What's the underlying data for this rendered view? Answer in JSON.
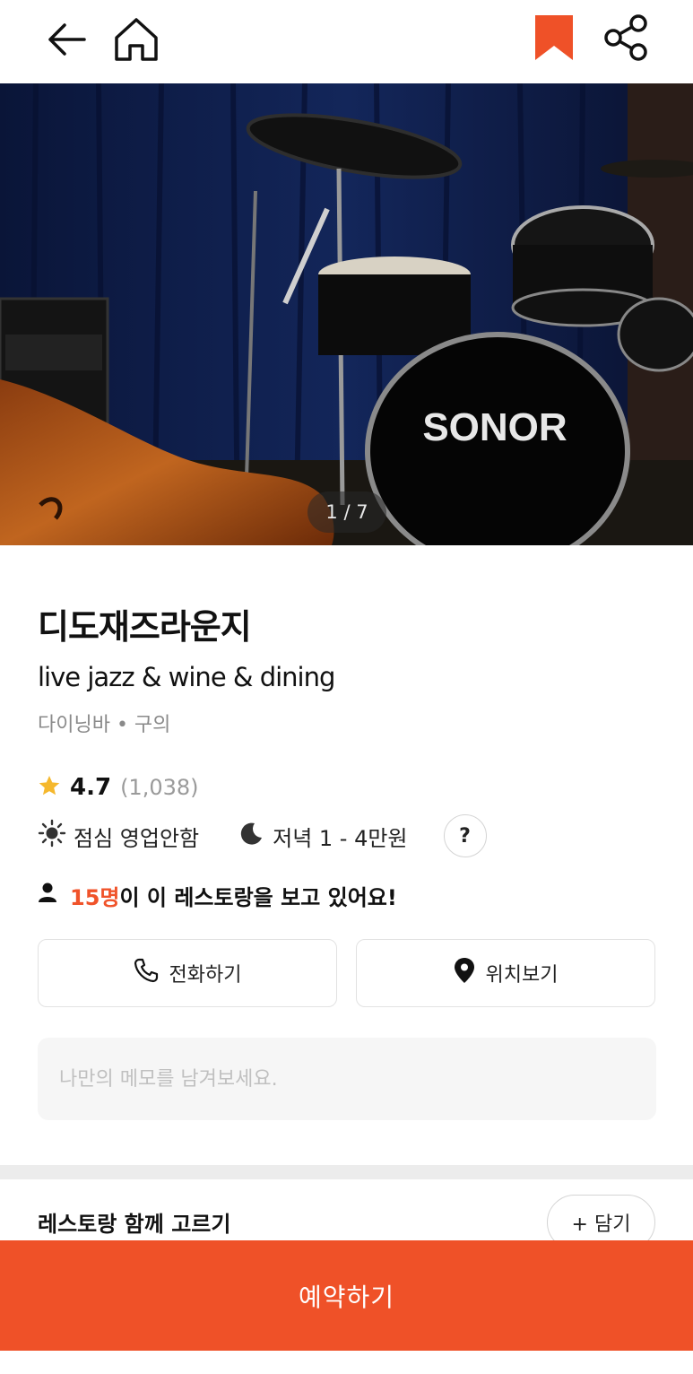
{
  "header": {
    "back_icon": "arrow-left-icon",
    "home_icon": "home-icon",
    "bookmark_icon": "bookmark-icon",
    "share_icon": "share-icon"
  },
  "gallery": {
    "counter": "1 / 7",
    "brand_text": "SONOR"
  },
  "restaurant": {
    "name": "디도재즈라운지",
    "tagline": "live jazz & wine & dining",
    "category": "다이닝바 • 구의",
    "rating": "4.7",
    "review_count": "(1,038)",
    "lunch": "점심 영업안함",
    "dinner": "저녁 1 - 4만원",
    "help_label": "?",
    "viewers_count": "15명",
    "viewers_text": "이 이 레스토랑을 보고 있어요!"
  },
  "actions": {
    "call_label": "전화하기",
    "map_label": "위치보기"
  },
  "memo": {
    "placeholder": "나만의 메모를 남겨보세요."
  },
  "compare": {
    "title": "레스토랑 함께 고르기",
    "add_label": "+ 담기"
  },
  "cta": {
    "reserve_label": "예약하기"
  },
  "colors": {
    "accent": "#ef5128",
    "star": "#f5b82e",
    "muted": "#8a8a8a"
  }
}
